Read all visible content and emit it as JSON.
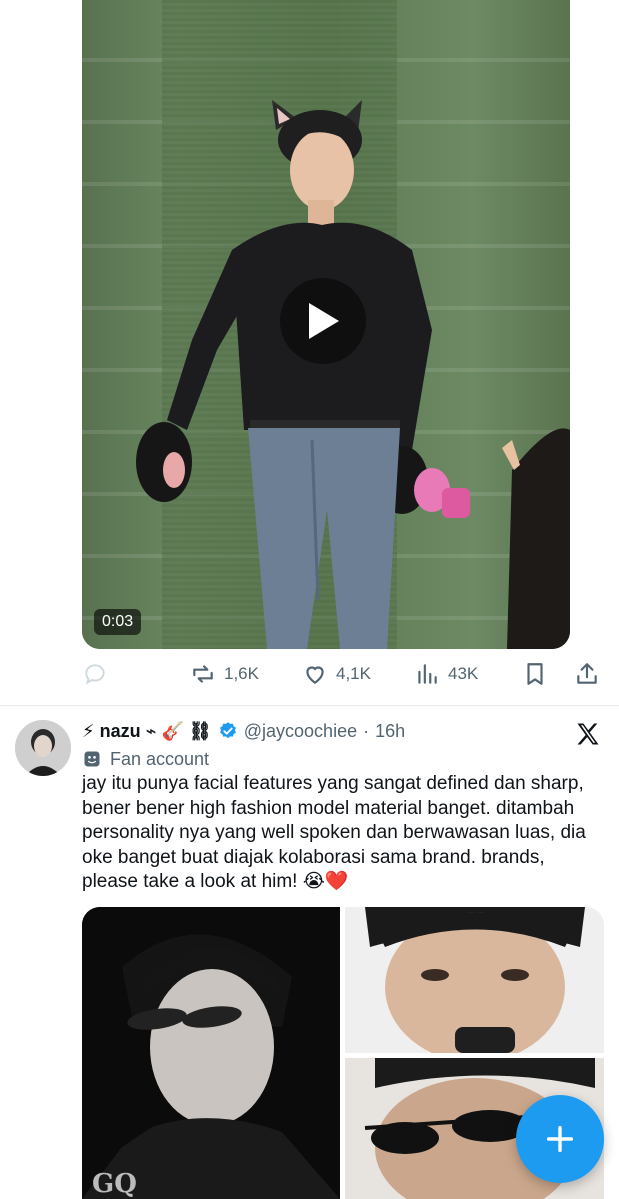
{
  "video": {
    "duration": "0:03"
  },
  "actions": {
    "reposts": "1,6K",
    "likes": "4,1K",
    "views": "43K"
  },
  "tweet": {
    "name": "⚡ nazu ⌁ 🎸 ⛓",
    "handle": "@jaycoochiee",
    "time": "16h",
    "separator": "·",
    "label": "Fan account",
    "text": "jay itu punya facial features yang sangat defined dan sharp, bener bener high fashion model material banget. ditambah personality nya yang well spoken dan berwawasan luas, dia oke banget buat diajak kolaborasi sama brand. brands, please take a look at him! 😭❤️"
  },
  "colors": {
    "accent": "#1d9bf0",
    "muted": "#536471",
    "text": "#0f1419"
  },
  "icons": {
    "reply": "reply-icon",
    "repost": "repost-icon",
    "like": "heart-icon",
    "views": "views-icon",
    "bookmark": "bookmark-icon",
    "share": "share-icon",
    "verified": "verified-badge-icon",
    "x": "x-logo-icon",
    "compose": "compose-plus-icon",
    "label": "theater-mask-icon"
  }
}
